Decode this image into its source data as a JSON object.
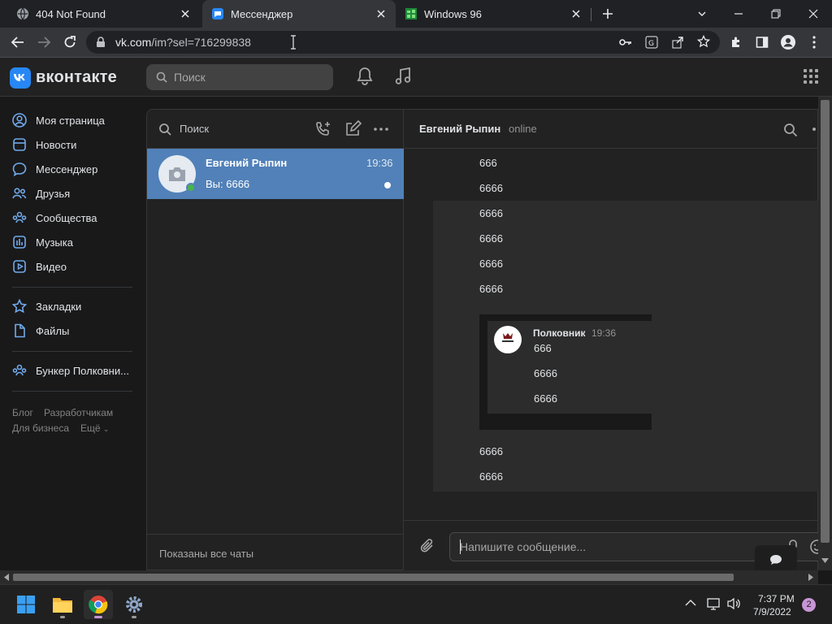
{
  "browser": {
    "tabs": [
      {
        "title": "404 Not Found",
        "active": false
      },
      {
        "title": "Мессенджер",
        "active": true
      },
      {
        "title": "Windows 96",
        "active": false
      }
    ],
    "url_host": "vk.com",
    "url_path": "/im?sel=716299838"
  },
  "vk": {
    "logo_text": "вконтакте",
    "search_placeholder": "Поиск",
    "nav": [
      {
        "label": "Моя страница",
        "icon": "user-circle-icon"
      },
      {
        "label": "Новости",
        "icon": "news-icon"
      },
      {
        "label": "Мессенджер",
        "icon": "message-icon"
      },
      {
        "label": "Друзья",
        "icon": "friends-icon"
      },
      {
        "label": "Сообщества",
        "icon": "communities-icon"
      },
      {
        "label": "Музыка",
        "icon": "music-icon"
      },
      {
        "label": "Видео",
        "icon": "video-icon"
      },
      {
        "label": "Закладки",
        "icon": "star-icon"
      },
      {
        "label": "Файлы",
        "icon": "files-icon"
      },
      {
        "label": "Бункер Полковни...",
        "icon": "group-icon"
      }
    ],
    "footer_links": [
      "Блог",
      "Разработчикам",
      "Для бизнеса",
      "Ещё"
    ]
  },
  "chats": {
    "search_label": "Поиск",
    "item": {
      "name": "Евгений Рыпин",
      "time": "19:36",
      "preview": "Вы: 6666"
    },
    "footer": "Показаны все чаты"
  },
  "conversation": {
    "name": "Евгений Рыпин",
    "status": "online",
    "messages_top": [
      "666",
      "6666",
      "6666",
      "6666",
      "6666",
      "6666"
    ],
    "forwarded": {
      "author": "Полковник",
      "time": "19:36",
      "messages": [
        "666",
        "6666",
        "6666"
      ]
    },
    "messages_bottom": [
      "6666",
      "6666"
    ],
    "composer_placeholder": "Напишите сообщение..."
  },
  "taskbar": {
    "time": "7:37 PM",
    "date": "7/9/2022",
    "notification_count": "2"
  },
  "colors": {
    "vk_blue": "#5181b8",
    "bg_dark": "#19191a",
    "panel": "#222222"
  }
}
